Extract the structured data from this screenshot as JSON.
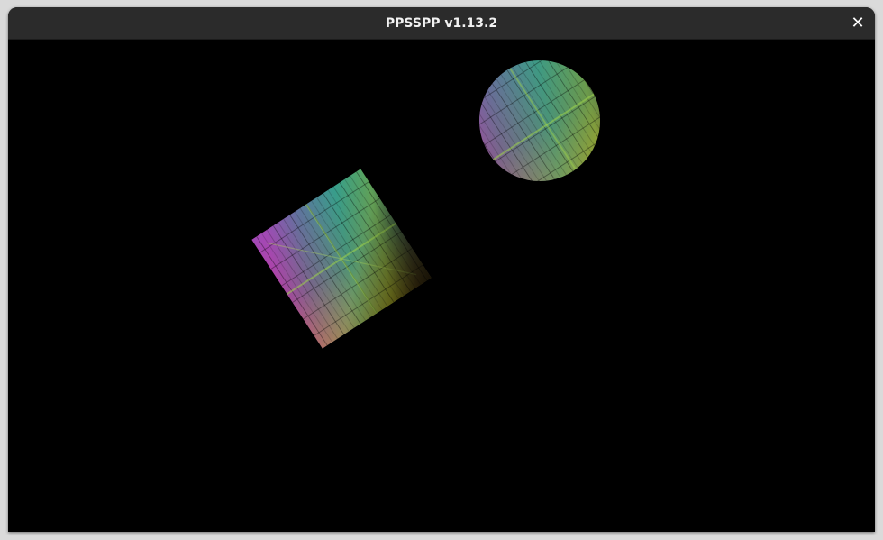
{
  "window": {
    "title": "PPSSPP v1.13.2",
    "close_glyph": "✕",
    "close_icon": "close-icon"
  },
  "scene": {
    "background": "#000000",
    "texture_colors": [
      "#ff00c8",
      "#d13aa0",
      "#7a4d9a",
      "#2fa3a0",
      "#1fbf8a",
      "#7cbf2a",
      "#c9b21f",
      "#e6a020"
    ],
    "objects": [
      {
        "name": "rotated-textured-square",
        "shape": "square"
      },
      {
        "name": "textured-circle",
        "shape": "circle"
      }
    ]
  }
}
